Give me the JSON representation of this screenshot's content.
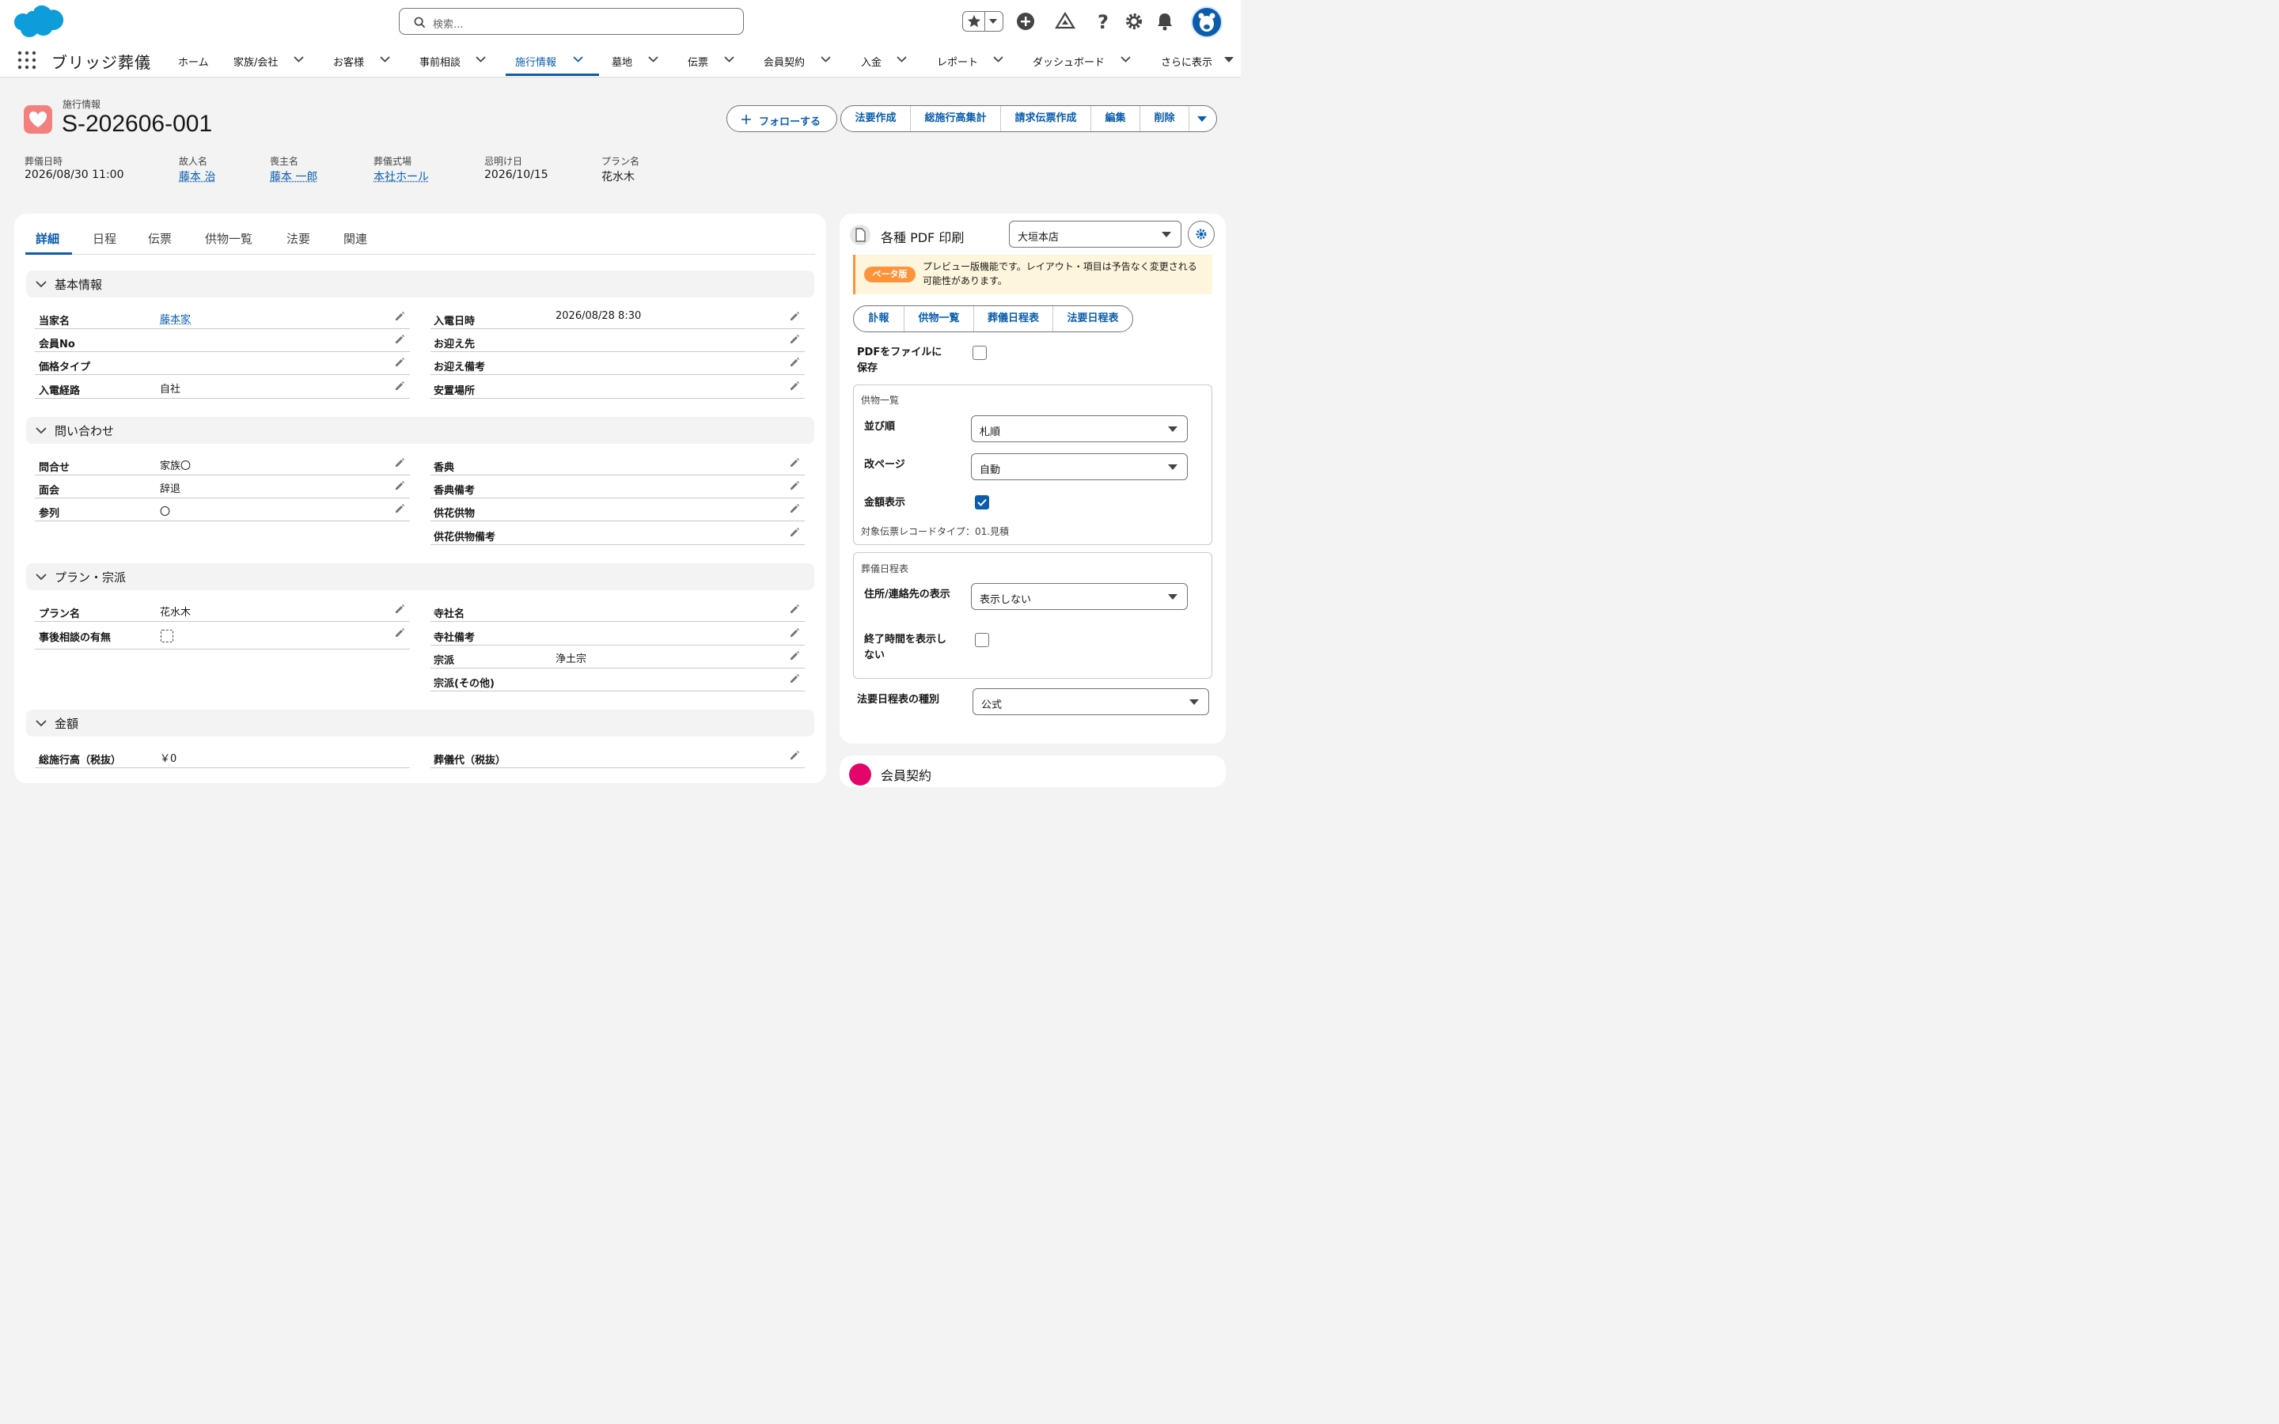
{
  "header": {
    "search_placeholder": "検索...",
    "app_name": "ブリッジ葬儀"
  },
  "nav": {
    "items": [
      "ホーム",
      "家族/会社",
      "お客様",
      "事前相談",
      "施行情報",
      "墓地",
      "伝票",
      "会員契約",
      "入金",
      "レポート",
      "ダッシュボード",
      "さらに表示"
    ],
    "active": "施行情報"
  },
  "record": {
    "object_label": "施行情報",
    "title": "S-202606-001",
    "follow_label": "フォローする",
    "actions": [
      "法要作成",
      "総施行高集計",
      "請求伝票作成",
      "編集",
      "削除"
    ],
    "highlights": [
      {
        "label": "葬儀日時",
        "value": "2026/08/30 11:00",
        "link": false
      },
      {
        "label": "故人名",
        "value": "藤本 治",
        "link": true
      },
      {
        "label": "喪主名",
        "value": "藤本 一郎",
        "link": true
      },
      {
        "label": "葬儀式場",
        "value": "本社ホール",
        "link": true
      },
      {
        "label": "忌明け日",
        "value": "2026/10/15",
        "link": false
      },
      {
        "label": "プラン名",
        "value": "花水木",
        "link": false
      }
    ]
  },
  "tabs": [
    "詳細",
    "日程",
    "伝票",
    "供物一覧",
    "法要",
    "関連"
  ],
  "sections": {
    "basic": {
      "title": "基本情報",
      "left": [
        {
          "label": "当家名",
          "value": "藤本家"
        },
        {
          "label": "会員No",
          "value": ""
        },
        {
          "label": "価格タイプ",
          "value": ""
        },
        {
          "label": "入電経路",
          "value": "自社"
        }
      ],
      "right": [
        {
          "label": "入電日時",
          "value": "2026/08/28 8:30"
        },
        {
          "label": "お迎え先",
          "value": ""
        },
        {
          "label": "お迎え備考",
          "value": ""
        },
        {
          "label": "安置場所",
          "value": ""
        }
      ]
    },
    "inquiry": {
      "title": "問い合わせ",
      "left": [
        {
          "label": "問合せ",
          "value": "家族〇"
        },
        {
          "label": "面会",
          "value": "辞退"
        },
        {
          "label": "参列",
          "value": "〇"
        }
      ],
      "right": [
        {
          "label": "香典",
          "value": ""
        },
        {
          "label": "香典備考",
          "value": ""
        },
        {
          "label": "供花供物",
          "value": ""
        },
        {
          "label": "供花供物備考",
          "value": ""
        }
      ]
    },
    "plan": {
      "title": "プラン・宗派",
      "left": [
        {
          "label": "プラン名",
          "value": "花水木"
        },
        {
          "label": "事後相談の有無",
          "value": ""
        }
      ],
      "right": [
        {
          "label": "寺社名",
          "value": ""
        },
        {
          "label": "寺社備考",
          "value": ""
        },
        {
          "label": "宗派",
          "value": "浄土宗"
        },
        {
          "label": "宗派(その他)",
          "value": ""
        }
      ]
    },
    "amount": {
      "title": "金額",
      "left": [
        {
          "label": "総施行高（税抜）",
          "value": "￥0"
        }
      ],
      "right": [
        {
          "label": "葬儀代（税抜）",
          "value": ""
        }
      ]
    }
  },
  "pdf": {
    "title": "各種 PDF 印刷",
    "branch": "大垣本店",
    "beta_badge": "ベータ版",
    "beta_text": "プレビュー版機能です。レイアウト・項目は予告なく変更される可能性があります。",
    "tabs": [
      "訃報",
      "供物一覧",
      "葬儀日程表",
      "法要日程表"
    ],
    "save_pdf_label": "PDFをファイルに保存",
    "offerings": {
      "title": "供物一覧",
      "order_label": "並び順",
      "order_value": "札順",
      "pagebreak_label": "改ページ",
      "pagebreak_value": "自動",
      "amount_label": "金額表示",
      "record_type_note": "対象伝票レコードタイプ：01.見積"
    },
    "schedule": {
      "title": "葬儀日程表",
      "address_label": "住所/連絡先の表示",
      "address_value": "表示しない",
      "hide_end_label": "終了時間を表示しない"
    },
    "memorial_type_label": "法要日程表の種別",
    "memorial_type_value": "公式",
    "next_card_title": "会員契約"
  },
  "colors": {
    "brand": "#0b5cab",
    "heart": "#f2807e",
    "beta": "#fe9339"
  }
}
